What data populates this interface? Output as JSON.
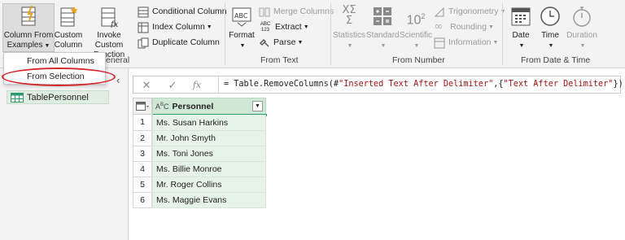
{
  "ribbon": {
    "general": {
      "column_from_examples": {
        "line1": "Column From",
        "line2": "Examples"
      },
      "custom_column": {
        "line1": "Custom",
        "line2": "Column"
      },
      "invoke_custom_function": {
        "line1": "Invoke Custom",
        "line2": "Function"
      },
      "conditional_column": "Conditional Column",
      "index_column": "Index Column",
      "duplicate_column": "Duplicate Column",
      "group_label_partial": "eneral"
    },
    "from_text": {
      "format": "Format",
      "merge_columns": "Merge Columns",
      "extract": "Extract",
      "parse": "Parse",
      "extract_icon_text": {
        "line1": "ABC",
        "line2": "123"
      },
      "group_label": "From Text"
    },
    "from_number": {
      "statistics": "Statistics",
      "standard": "Standard",
      "scientific": "Scientific",
      "trigonometry": "Trigonometry",
      "rounding": "Rounding",
      "information": "Information",
      "statistics_glyph": "ΧΣ",
      "statistics_glyph2": "Σ",
      "scientific_glyph": "10",
      "scientific_sup": "2",
      "rounding_glyph": ".00",
      "group_label": "From Number"
    },
    "from_date_time": {
      "date": "Date",
      "time": "Time",
      "duration": "Duration",
      "group_label": "From Date & Time"
    }
  },
  "dropdown_menu": {
    "items": [
      {
        "label": "From All Columns"
      },
      {
        "label": "From Selection"
      }
    ]
  },
  "formula_bar": {
    "cancel_glyph": "✕",
    "confirm_glyph": "✓",
    "fx_glyph": "fx",
    "formula_prefix": "= Table.RemoveColumns(#",
    "formula_string1": "\"Inserted Text After Delimiter\"",
    "formula_middle": ",{",
    "formula_string2": "\"Text After Delimiter\"",
    "formula_suffix": "})"
  },
  "queries": {
    "collapse_glyph": "‹",
    "items": [
      {
        "name": "TablePersonnel"
      }
    ]
  },
  "table": {
    "column_header": "Personnel",
    "type_glyph": "A",
    "type_glyph_sub": "B",
    "type_glyph_c": "C",
    "rows": [
      {
        "index": "1",
        "value": "Ms. Susan Harkins"
      },
      {
        "index": "2",
        "value": "Mr. John Smyth"
      },
      {
        "index": "3",
        "value": "Ms. Toni Jones"
      },
      {
        "index": "4",
        "value": "Ms. Billie Monroe"
      },
      {
        "index": "5",
        "value": "Mr. Roger Collins"
      },
      {
        "index": "6",
        "value": "Ms. Maggie Evans"
      }
    ]
  },
  "colors": {
    "accent_green": "#2e9b6e",
    "cell_green": "#e6f3e8",
    "header_green": "#cfe8d3",
    "highlight_red": "#d6262a"
  }
}
